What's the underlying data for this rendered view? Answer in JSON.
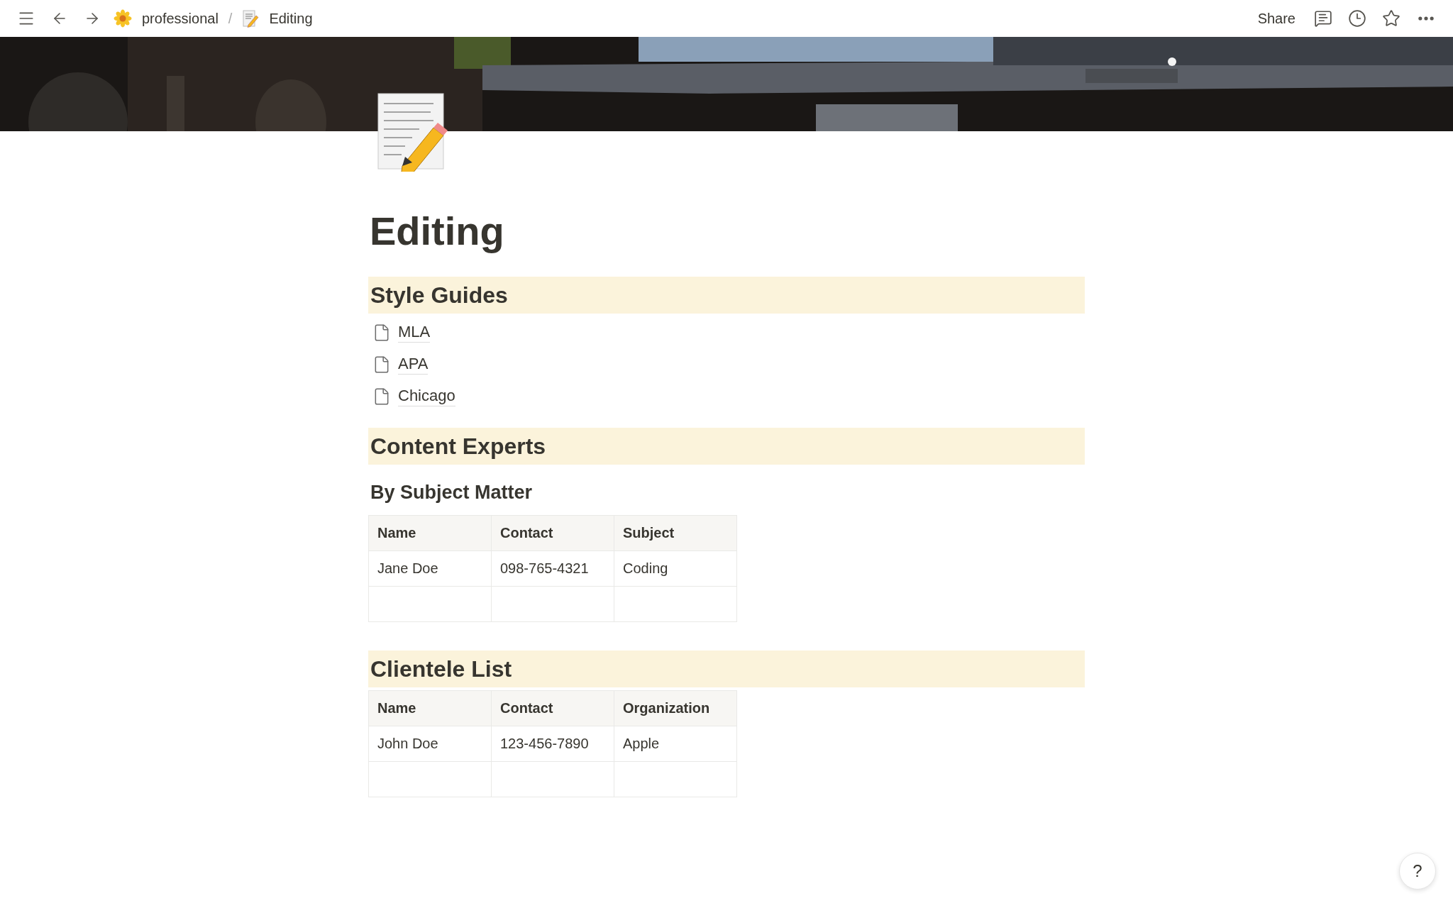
{
  "topbar": {
    "breadcrumbs": [
      {
        "label": "professional"
      },
      {
        "label": "Editing"
      }
    ],
    "separator": "/",
    "share": "Share"
  },
  "page": {
    "title": "Editing"
  },
  "blocks": [
    {
      "kind": "heading",
      "text": "Style Guides"
    },
    {
      "kind": "page_link",
      "text": "MLA"
    },
    {
      "kind": "page_link",
      "text": "APA"
    },
    {
      "kind": "page_link",
      "text": "Chicago"
    },
    {
      "kind": "heading",
      "text": "Content Experts"
    },
    {
      "kind": "subheading",
      "text": "By Subject Matter"
    },
    {
      "kind": "table",
      "columns": [
        "Name",
        "Contact",
        "Subject"
      ],
      "rows": [
        [
          "Jane Doe",
          "098-765-4321",
          "Coding"
        ]
      ]
    },
    {
      "kind": "heading",
      "text": "Clientele List"
    },
    {
      "kind": "table",
      "columns": [
        "Name",
        "Contact",
        "Organization"
      ],
      "rows": [
        [
          "John Doe",
          "123-456-7890",
          "Apple"
        ]
      ]
    }
  ],
  "help": "?"
}
